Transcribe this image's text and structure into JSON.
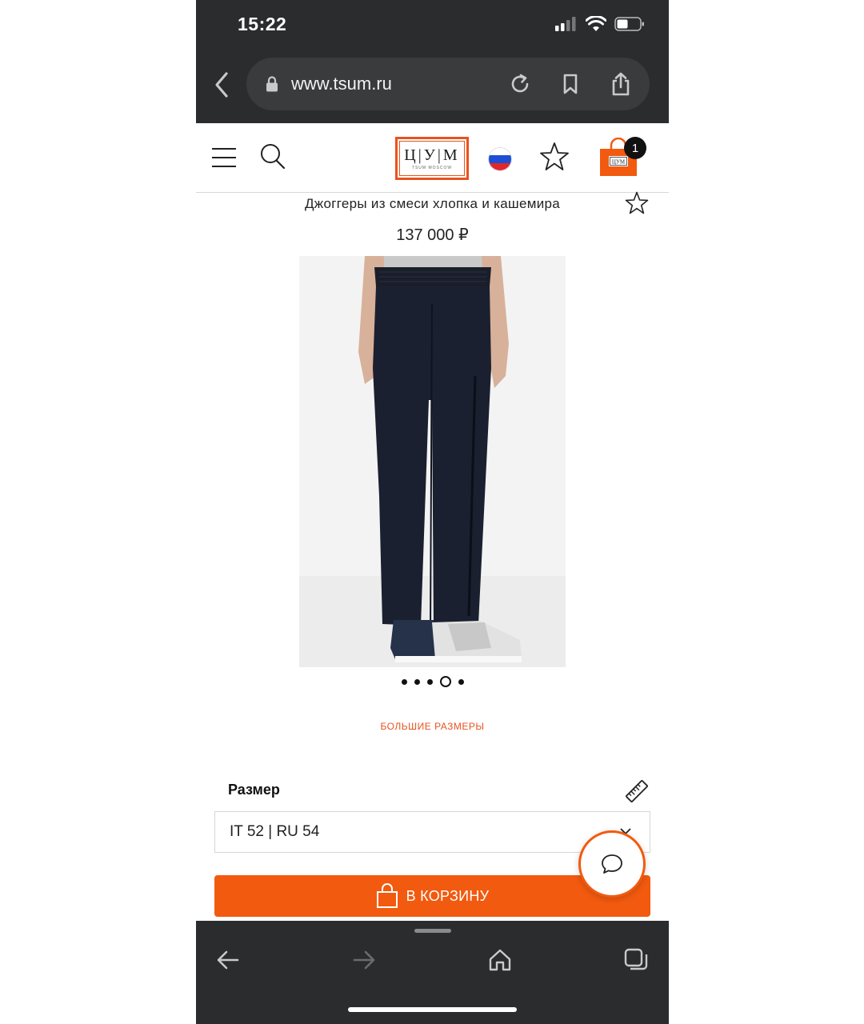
{
  "status_bar": {
    "time": "15:22",
    "icons": [
      "signal-icon",
      "wifi-icon",
      "battery-icon"
    ]
  },
  "browser": {
    "url": "www.tsum.ru",
    "icons": [
      "back-icon",
      "lock-icon",
      "reload-icon",
      "bookmark-icon",
      "share-icon"
    ]
  },
  "site_header": {
    "logo_letters": "Ц|У|М",
    "logo_sub": "TSUM MOSCOW",
    "cart_count": "1",
    "icons": [
      "menu-icon",
      "search-icon",
      "russia-flag-icon",
      "favorites-star-icon",
      "cart-bag-icon"
    ]
  },
  "product": {
    "title": "Джоггеры из смеси хлопка и кашемира",
    "price": "137 000 ₽",
    "gallery_total": 5,
    "gallery_active": 4,
    "big_sizes_link": "БОЛЬШИЕ РАЗМЕРЫ",
    "size_label": "Размер",
    "size_selected": "IT 52 | RU 54",
    "add_to_cart": "В КОРЗИНУ"
  },
  "bottom_bar": {
    "icons": [
      "nav-back-icon",
      "nav-forward-icon",
      "home-icon",
      "tabs-icon"
    ]
  },
  "colors": {
    "accent": "#f25a0f",
    "chrome": "#2b2c2e",
    "logo": "#e8521e"
  }
}
